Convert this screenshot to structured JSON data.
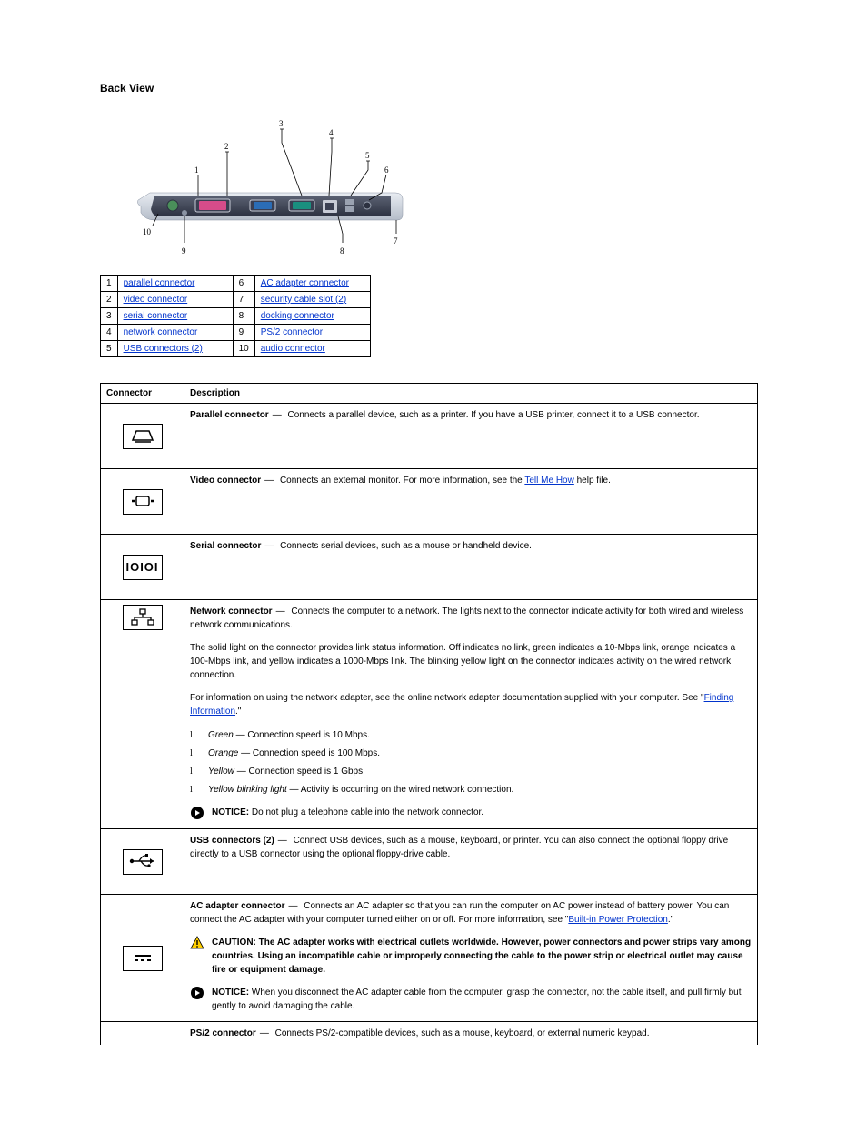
{
  "heading": "Back View",
  "refs": [
    {
      "n": "1",
      "label": "parallel connector",
      "n2": "6",
      "label2": "AC adapter connector"
    },
    {
      "n": "2",
      "label": "video connector",
      "n2": "7",
      "label2": "security cable slot (2)"
    },
    {
      "n": "3",
      "label": "serial connector",
      "n2": "8",
      "label2": "docking connector"
    },
    {
      "n": "4",
      "label": "network connector",
      "n2": "9",
      "label2": "PS/2 connector"
    },
    {
      "n": "5",
      "label": "USB connectors (2)",
      "n2": "10",
      "label2": "audio connector"
    }
  ],
  "legend": {
    "n1": "1",
    "n2": "2",
    "n3": "3",
    "n4": "4",
    "n5": "5",
    "n6": "6",
    "n7": "7",
    "n8": "8",
    "n9": "9",
    "n10": "10"
  },
  "conn_header": {
    "col1": "Connector",
    "col2": "Description"
  },
  "rows": {
    "parallel": {
      "label": "Parallel connector",
      "dash": "—",
      "text": " Connects a parallel device, such as a printer. If you have a USB printer, connect it to a USB connector."
    },
    "video": {
      "label": "Video connector",
      "dash": "—",
      "text": " Connects an external monitor. For more information, see the ",
      "link": "Tell Me How",
      "after": " help file."
    },
    "serial": {
      "label": "Serial connector",
      "dash": "—",
      "text": " Connects serial devices, such as a mouse or handheld device."
    },
    "network": {
      "label": "Network connector",
      "dash": "—",
      "text": " Connects the computer to a network. The lights next to the connector indicate activity for both wired and wireless network communications.",
      "para2": "The solid light on the connector provides link status information. Off indicates no link, green indicates a 10-Mbps link, orange indicates a 100-Mbps link, and yellow indicates a 1000-Mbps link. The blinking yellow light on the connector indicates activity on the wired network connection.",
      "para3": "For information on using the network adapter, see the online network adapter documentation supplied with your computer. See \"",
      "link": "Finding Information",
      "after3": ".\"",
      "li_green": {
        "em": "Green",
        "dash": "—",
        "text": " Connection speed is 10 Mbps."
      },
      "li_orange": {
        "em": "Orange",
        "dash": "—",
        "text": " Connection speed is 100 Mbps."
      },
      "li_yellow": {
        "em": "Yellow",
        "dash": "—",
        "text": " Connection speed is 1 Gbps."
      },
      "li_yellow_blink": {
        "em": "Yellow blinking light",
        "dash": "—",
        "text": " Activity is occurring on the wired network connection."
      },
      "notice_lead": "NOTICE:",
      "notice_text": " Do not plug a telephone cable into the network connector."
    },
    "usb": {
      "label": "USB connectors (2)",
      "dash": "—",
      "text": " Connect USB devices, such as a mouse, keyboard, or printer. You can also connect the optional floppy drive directly to a USB connector using the optional floppy-drive cable."
    },
    "ac": {
      "label": "AC adapter connector",
      "dash": "—",
      "text": " Connects an AC adapter so that you can run the computer on AC power instead of battery power. You can connect the AC adapter with your computer turned either on or off. For more information, see \"",
      "link": "Built-in Power Protection",
      "after": ".\"",
      "caution_lead": "CAUTION: ",
      "caution_text": "The AC adapter works with electrical outlets worldwide. However, power connectors and power strips vary among countries. Using an incompatible cable or improperly connecting the cable to the power strip or electrical outlet may cause fire or equipment damage.",
      "notice_lead": "NOTICE:",
      "notice_text": " When you disconnect the AC adapter cable from the computer, grasp the connector, not the cable itself, and pull firmly but gently to avoid damaging the cable."
    },
    "ps2": {
      "label": "PS/2 connector",
      "dash": "—",
      "text": " Connects PS/2-compatible devices, such as a mouse, keyboard, or external numeric keypad."
    }
  }
}
